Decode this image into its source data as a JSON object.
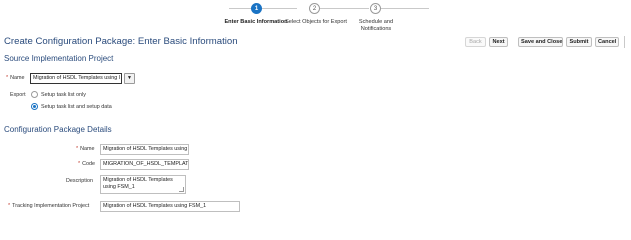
{
  "train": {
    "steps": [
      {
        "number": "1",
        "label": "Enter Basic Information",
        "state": "active"
      },
      {
        "number": "2",
        "label": "Select Objects for Export",
        "state": "inactive"
      },
      {
        "number": "3",
        "label_line1": "Schedule and",
        "label_line2": "Notifications",
        "state": "inactive"
      }
    ]
  },
  "header": {
    "title": "Create Configuration Package: Enter Basic Information",
    "buttons": {
      "back": "Back",
      "next": "Next",
      "save_close": "Save and Close",
      "submit": "Submit",
      "cancel": "Cancel"
    }
  },
  "source_section": {
    "title": "Source Implementation Project",
    "name_label": "Name",
    "name_value": "Migration of HSDL Templates using I",
    "export_label": "Export",
    "export_options": [
      {
        "label": "Setup task list only",
        "selected": false
      },
      {
        "label": "Setup task list and setup data",
        "selected": true
      }
    ]
  },
  "details_section": {
    "title": "Configuration Package Details",
    "name_label": "Name",
    "name_value": "Migration of HSDL Templates using I",
    "code_label": "Code",
    "code_value": "MIGRATION_OF_HSDL_TEMPLATE",
    "description_label": "Description",
    "description_line1": "Migration of HSDL Templates",
    "description_line2": "using FSM_1",
    "tracking_label": "Tracking Implementation Project",
    "tracking_value": "Migration of HSDL Templates using FSM_1"
  },
  "colors": {
    "accent": "#1a73c4",
    "title_text": "#2a4b7c",
    "required": "#c0392b"
  }
}
